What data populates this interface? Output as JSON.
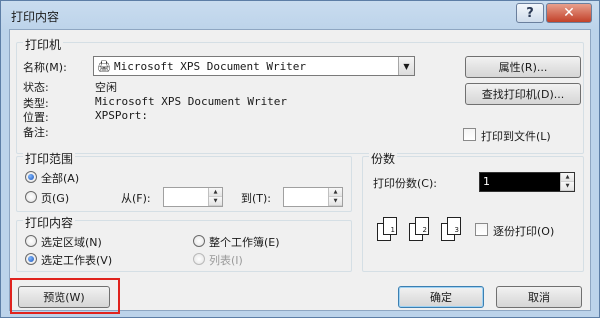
{
  "window": {
    "title": "打印内容",
    "help_glyph": "?",
    "close_glyph": "✕"
  },
  "printer": {
    "group_label": "打印机",
    "name_label": "名称(M):",
    "name_value": "Microsoft XPS Document Writer",
    "status_label": "状态:",
    "status_value": "空闲",
    "type_label": "类型:",
    "type_value": "Microsoft XPS Document Writer",
    "location_label": "位置:",
    "location_value": "XPSPort:",
    "comment_label": "备注:",
    "comment_value": "",
    "properties_button": "属性(R)...",
    "find_printer_button": "查找打印机(D)...",
    "print_to_file_label": "打印到文件(L)",
    "print_to_file_checked": false
  },
  "range": {
    "group_label": "打印范围",
    "all_label": "全部(A)",
    "all_checked": true,
    "pages_label": "页(G)",
    "from_label": "从(F):",
    "from_value": "",
    "to_label": "到(T):",
    "to_value": ""
  },
  "copies": {
    "group_label": "份数",
    "count_label": "打印份数(C):",
    "count_value": "1",
    "collate_label": "逐份打印(O)",
    "collate_checked": false,
    "collate_page_labels": [
      "1",
      "1",
      "2",
      "2",
      "3",
      "3"
    ]
  },
  "content": {
    "group_label": "打印内容",
    "selection_label": "选定区域(N)",
    "whole_workbook_label": "整个工作簿(E)",
    "active_sheets_label": "选定工作表(V)",
    "active_sheets_checked": true,
    "list_label": "列表(I)"
  },
  "footer": {
    "preview_button": "预览(W)",
    "ok_button": "确定",
    "cancel_button": "取消"
  },
  "colors": {
    "highlight": "#e0231e",
    "title_bar": "#bcd3ea",
    "close_button": "#c2412a"
  }
}
